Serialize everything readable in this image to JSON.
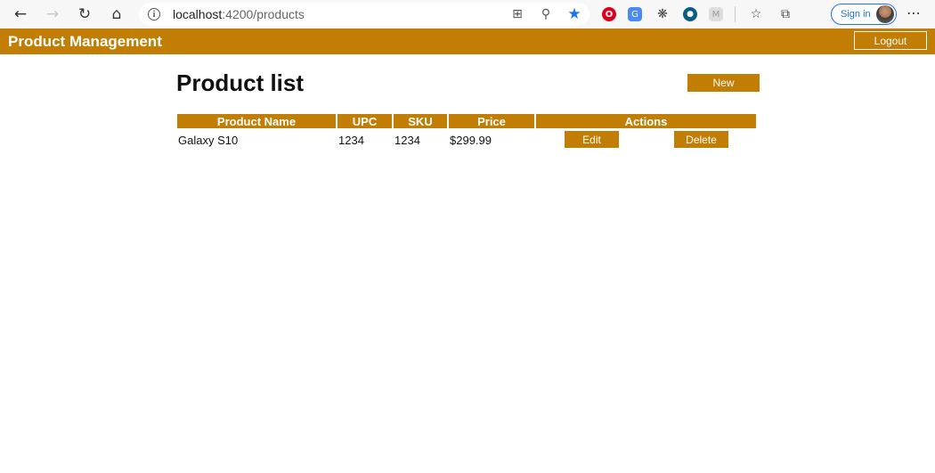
{
  "browser": {
    "url_host": "localhost",
    "url_path": ":4200/products",
    "signin_label": "Sign in"
  },
  "app": {
    "title": "Product Management",
    "logout_label": "Logout"
  },
  "page": {
    "title": "Product list",
    "new_label": "New"
  },
  "table": {
    "headers": [
      "Product Name",
      "UPC",
      "SKU",
      "Price",
      "Actions"
    ],
    "rows": [
      {
        "name": "Galaxy S10",
        "upc": "1234",
        "sku": "1234",
        "price": "$299.99",
        "edit_label": "Edit",
        "delete_label": "Delete"
      }
    ]
  },
  "colors": {
    "accent": "#c17d04",
    "accent_text": "#ffffff"
  }
}
